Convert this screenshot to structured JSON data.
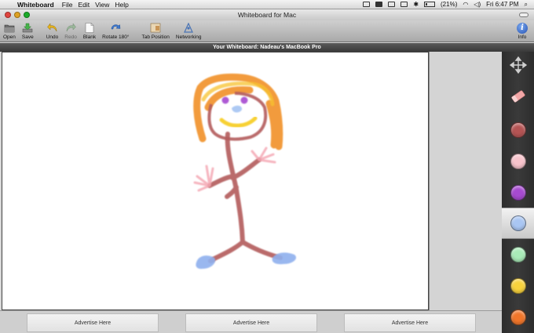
{
  "menubar": {
    "app_name": "Whiteboard",
    "items": [
      "File",
      "Edit",
      "View",
      "Help"
    ],
    "battery_text": "(21%)",
    "clock": "Fri 6:47 PM"
  },
  "window": {
    "title": "Whiteboard for Mac"
  },
  "toolbar": {
    "open_label": "Open",
    "save_label": "Save",
    "undo_label": "Undo",
    "redo_label": "Redo",
    "blank_label": "Blank",
    "rotate_label": "Rotate 180°",
    "tab_position_label": "Tab Position",
    "networking_label": "Networking",
    "info_label": "Info"
  },
  "caption": "Your Whiteboard: Nadeau's MacBook Pro",
  "palette": {
    "tools": [
      "move-icon",
      "eraser-icon"
    ],
    "colors": [
      {
        "name": "red",
        "hex": "#b45454",
        "selected": false
      },
      {
        "name": "pink",
        "hex": "#f8c4cc",
        "selected": false
      },
      {
        "name": "purple",
        "hex": "#a64ad0",
        "selected": false
      },
      {
        "name": "light-blue",
        "hex": "#a9c6f3",
        "selected": true
      },
      {
        "name": "light-green",
        "hex": "#a9ebb8",
        "selected": false
      },
      {
        "name": "yellow",
        "hex": "#f8d23c",
        "selected": false
      },
      {
        "name": "orange",
        "hex": "#f2762a",
        "selected": false
      }
    ]
  },
  "ads": {
    "ad1": "Advertise Here",
    "ad2": "Advertise Here",
    "ad3": "Advertise Here"
  }
}
